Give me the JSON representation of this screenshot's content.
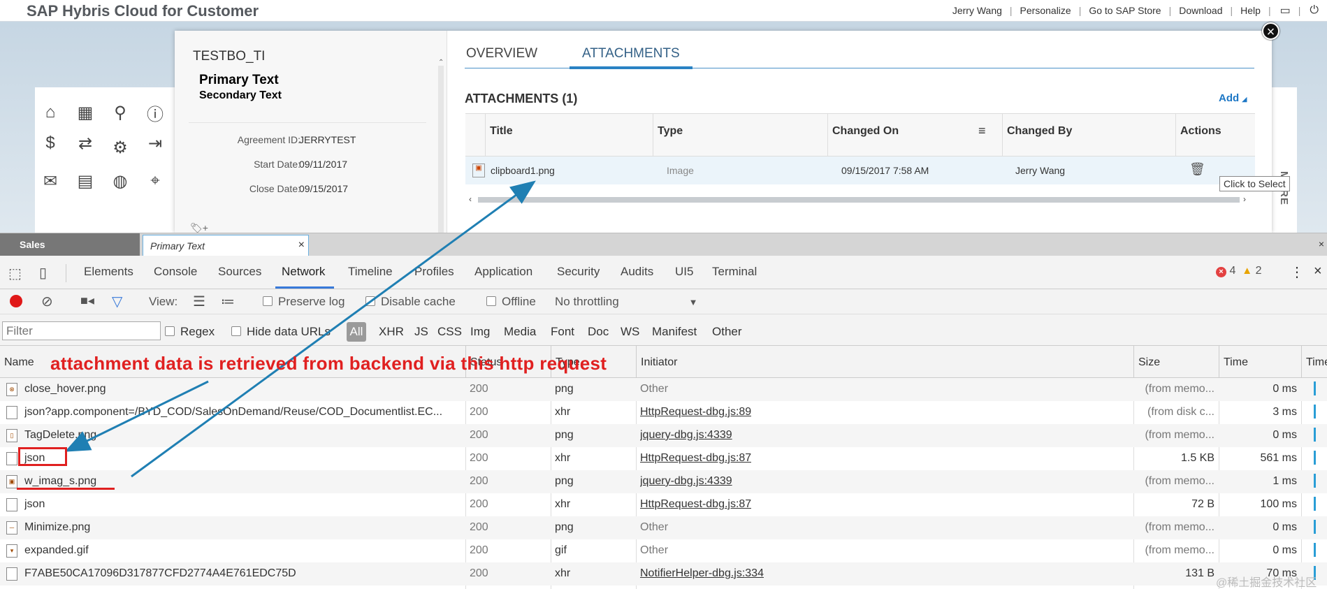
{
  "app": {
    "title": "SAP Hybris Cloud for Customer",
    "nav": [
      "Jerry Wang",
      "Personalize",
      "Go to SAP Store",
      "Download",
      "Help"
    ]
  },
  "launchpad": {
    "icons": [
      "home-icon",
      "calendar-icon",
      "search-icon",
      "alert-icon",
      "dollar-icon",
      "swap-icon",
      "gear-icon",
      "money-arrow-icon",
      "chat-dollar-icon",
      "dollar-doc-icon",
      "globe-icon",
      "map-pin-icon"
    ]
  },
  "dialog": {
    "object_id": "TESTBO_TI",
    "primary_text": "Primary Text",
    "secondary_text": "Secondary Text",
    "fields": [
      {
        "label": "Agreement ID:",
        "value": "JERRYTEST"
      },
      {
        "label": "Start Date:",
        "value": "09/11/2017"
      },
      {
        "label": "Close Date:",
        "value": "09/15/2017"
      }
    ],
    "tabs": [
      "OVERVIEW",
      "ATTACHMENTS"
    ],
    "active_tab": "ATTACHMENTS",
    "attachments_heading": "ATTACHMENTS (1)",
    "add_label": "Add",
    "columns": [
      "Title",
      "Type",
      "Changed On",
      "Changed By",
      "Actions"
    ],
    "rows": [
      {
        "title": "clipboard1.png",
        "type": "Image",
        "changed_on": "09/15/2017 7:58 AM",
        "changed_by": "Jerry Wang"
      }
    ],
    "tooltip": "Click to Select",
    "more_label": "MORE"
  },
  "tabstrip": {
    "sales": "Sales",
    "primary": "Primary Text"
  },
  "devtools": {
    "tabs": [
      "Elements",
      "Console",
      "Sources",
      "Network",
      "Timeline",
      "Profiles",
      "Application",
      "Security",
      "Audits",
      "UI5",
      "Terminal"
    ],
    "active_tab": "Network",
    "errors": "4",
    "warnings": "2",
    "toolbar": {
      "view_label": "View:",
      "preserve_log": "Preserve log",
      "disable_cache": "Disable cache",
      "offline": "Offline",
      "throttling": "No throttling"
    },
    "filter": {
      "placeholder": "Filter",
      "regex": "Regex",
      "hide_data_urls": "Hide data URLs",
      "types": [
        "All",
        "XHR",
        "JS",
        "CSS",
        "Img",
        "Media",
        "Font",
        "Doc",
        "WS",
        "Manifest",
        "Other"
      ]
    },
    "columns": [
      "Name",
      "Status",
      "Type",
      "Initiator",
      "Size",
      "Time",
      "Timeline"
    ],
    "rows": [
      {
        "name": "close_hover.png",
        "status": "200",
        "type": "png",
        "initiator": "Other",
        "size": "(from memo...",
        "time": "0 ms"
      },
      {
        "name": "json?app.component=/BYD_COD/SalesOnDemand/Reuse/COD_Documentlist.EC...",
        "status": "200",
        "type": "xhr",
        "initiator": "HttpRequest-dbg.js:89",
        "size": "(from disk c...",
        "time": "3 ms"
      },
      {
        "name": "TagDelete.png",
        "status": "200",
        "type": "png",
        "initiator": "jquery-dbg.js:4339",
        "size": "(from memo...",
        "time": "0 ms"
      },
      {
        "name": "json",
        "status": "200",
        "type": "xhr",
        "initiator": "HttpRequest-dbg.js:87",
        "size": "1.5 KB",
        "time": "561 ms"
      },
      {
        "name": "w_imag_s.png",
        "status": "200",
        "type": "png",
        "initiator": "jquery-dbg.js:4339",
        "size": "(from memo...",
        "time": "1 ms"
      },
      {
        "name": "json",
        "status": "200",
        "type": "xhr",
        "initiator": "HttpRequest-dbg.js:87",
        "size": "72 B",
        "time": "100 ms"
      },
      {
        "name": "Minimize.png",
        "status": "200",
        "type": "png",
        "initiator": "Other",
        "size": "(from memo...",
        "time": "0 ms"
      },
      {
        "name": "expanded.gif",
        "status": "200",
        "type": "gif",
        "initiator": "Other",
        "size": "(from memo...",
        "time": "0 ms"
      },
      {
        "name": "F7ABE50CA17096D317877CFD2774A4E761EDC75D",
        "status": "200",
        "type": "xhr",
        "initiator": "NotifierHelper-dbg.js:334",
        "size": "131 B",
        "time": "70 ms"
      }
    ]
  },
  "annotation": "attachment data is retrieved from backend via this http request",
  "watermark": "@稀土掘金技术社区",
  "colors": {
    "accent": "#2a82c4",
    "annotation_red": "#e02020",
    "arrow": "#1f7fb3"
  }
}
